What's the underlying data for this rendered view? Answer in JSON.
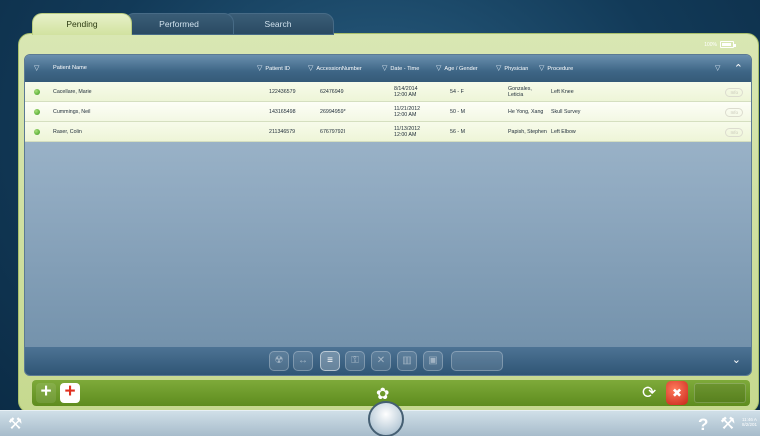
{
  "tabs": [
    {
      "label": "Pending",
      "active": true
    },
    {
      "label": "Performed",
      "active": false
    },
    {
      "label": "Search",
      "active": false
    }
  ],
  "status": {
    "battery_label": "100%"
  },
  "table": {
    "headers": {
      "patient_name": "Patient Name",
      "patient_id": "Patient ID",
      "accession": "AccessionNumber",
      "date_time": "Date - Time",
      "age_gender": "Age / Gender",
      "physician": "Physician",
      "procedure": "Procedure"
    },
    "rows": [
      {
        "name": "Cacellare, Marie",
        "id": "122436579",
        "accession": "62476949",
        "date": "8/14/2014",
        "time": "12:00 AM",
        "age_gender": "54 - F",
        "physician": "Gonzales,",
        "physician2": "Leticia",
        "procedure": "Left Knee",
        "info": "Info"
      },
      {
        "name": "Cummings, Neil",
        "id": "143165498",
        "accession": "26994959*",
        "date": "11/21/2012",
        "time": "12:00 AM",
        "age_gender": "50 - M",
        "physician": "He Yong, Xang",
        "physician2": "",
        "procedure": "Skull Survey",
        "info": "Info"
      },
      {
        "name": "Raser, Colin",
        "id": "211346579",
        "accession": "67679792I",
        "date": "11/13/2012",
        "time": "12:00 AM",
        "age_gender": "56 - M",
        "physician": "Papish, Stephen",
        "physician2": "",
        "procedure": "Left Elbow",
        "info": "Info"
      }
    ]
  },
  "icons": {
    "sort": "▽",
    "collapse": "⌃⌃",
    "expand": "⌄⌄",
    "add": "+",
    "sync": "⟳",
    "leaf": "✿",
    "help": "?",
    "wrench": "🔧"
  },
  "system": {
    "time": "11:46 A",
    "date": "8/2/201"
  }
}
